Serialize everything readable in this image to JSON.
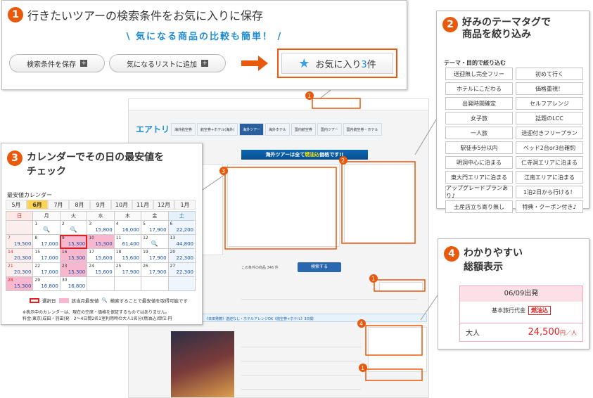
{
  "panel1": {
    "number": "1",
    "title": "行きたいツアーの検索条件をお気に入りに保存",
    "subtitle": "\\ 気になる商品の比較も簡単！ /",
    "save_label": "検索条件を保存",
    "add_label": "気になるリストに追加",
    "plus": "+",
    "fav_label": "お気に入り",
    "fav_count": "3",
    "fav_unit": "件",
    "icon": "star-icon"
  },
  "panel2": {
    "number": "2",
    "title_line1": "好みのテーマタグで",
    "title_line2": "商品を絞り込み",
    "section": "テーマ・目的で絞り込む",
    "tags": [
      "送迎無し完全フリー",
      "初めて行く",
      "ホテルにこだわる",
      "価格重視！",
      "出発時間確定",
      "セルフアレンジ",
      "女子旅",
      "話題のLCC",
      "一人旅",
      "送迎付きフリープラン",
      "駅徒歩5分以内",
      "ベッド2台or3台確約",
      "明洞中心に泊まる",
      "仁寺洞エリアに泊まる",
      "東大門エリアに泊まる",
      "江南エリアに泊まる",
      "アップグレードプランあり♪",
      "1泊2日から行ける！",
      "土産店立ち寄り無し",
      "特典・クーポン付き♪"
    ]
  },
  "panel3": {
    "number": "3",
    "title_line1": "カレンダーでその日の最安値を",
    "title_line2": "チェック",
    "calendar_label": "最安値カレンダー",
    "months": [
      "5月",
      "6月",
      "7月",
      "8月",
      "9月",
      "10月",
      "11月",
      "12月",
      "1月"
    ],
    "weekdays": [
      "日",
      "月",
      "火",
      "水",
      "木",
      "金",
      "土"
    ],
    "weeks": [
      [
        {
          "d": "",
          "p": ""
        },
        {
          "d": "1",
          "p": "",
          "mag": true
        },
        {
          "d": "2",
          "p": "",
          "mag": true
        },
        {
          "d": "3",
          "p": "15,800"
        },
        {
          "d": "4",
          "p": "16,000"
        },
        {
          "d": "5",
          "p": "17,900"
        },
        {
          "d": "6",
          "p": "22,200"
        }
      ],
      [
        {
          "d": "7",
          "p": "19,500"
        },
        {
          "d": "8",
          "p": "17,000"
        },
        {
          "d": "9",
          "p": "15,300",
          "sel": true,
          "cheap": true
        },
        {
          "d": "10",
          "p": "15,300",
          "cheap": true
        },
        {
          "d": "11",
          "p": "61,400"
        },
        {
          "d": "12",
          "p": "",
          "mag": true
        },
        {
          "d": "13",
          "p": "44,800"
        }
      ],
      [
        {
          "d": "14",
          "p": "20,300"
        },
        {
          "d": "15",
          "p": "17,000"
        },
        {
          "d": "16",
          "p": "15,300",
          "cheap": true
        },
        {
          "d": "17",
          "p": "15,600"
        },
        {
          "d": "18",
          "p": "15,600"
        },
        {
          "d": "19",
          "p": "17,900"
        },
        {
          "d": "20",
          "p": "22,300"
        }
      ],
      [
        {
          "d": "21",
          "p": "20,300"
        },
        {
          "d": "22",
          "p": "17,000"
        },
        {
          "d": "23",
          "p": "15,300",
          "cheap": true
        },
        {
          "d": "24",
          "p": "15,600"
        },
        {
          "d": "25",
          "p": "17,900"
        },
        {
          "d": "26",
          "p": "17,900"
        },
        {
          "d": "27",
          "p": "22,300"
        }
      ],
      [
        {
          "d": "28",
          "p": "15,300",
          "cheap": true
        },
        {
          "d": "29",
          "p": "16,800"
        },
        {
          "d": "30",
          "p": "16,800"
        },
        {
          "d": "",
          "p": ""
        },
        {
          "d": "",
          "p": ""
        },
        {
          "d": "",
          "p": ""
        },
        {
          "d": "",
          "p": ""
        }
      ]
    ],
    "legend_selected": "選択日",
    "legend_cheapest": "該当月最安値",
    "legend_search": "検索することで最安値を取得可能です",
    "note_line1": "※表示中のカレンダーは、現在の空席・価格を保証するものではありません。",
    "note_line2": "料金:東京(成田・羽田)発　2〜4日間2名1室利用時の大人1名分(燃油込)単位:円"
  },
  "panel4": {
    "number": "4",
    "title_line1": "わかりやすい",
    "title_line2": "総額表示",
    "date_label": "06/09出発",
    "base_label": "基本旅行代金",
    "fuel_label": "燃油込",
    "adult_label": "大人",
    "price": "24,500",
    "price_unit": "円／人"
  },
  "site": {
    "logo": "エアトリ",
    "band_pre": "海外ツアーは全て",
    "band_hi": "燃油込",
    "band_post": "価格です!!",
    "nav": [
      "海外航空券",
      "航空券+ホテル(海外)",
      "海外ツアー",
      "海外ホテル",
      "国内航空券",
      "国内ツアー",
      "国内航空券・ホテル",
      "新幹線・ホテル"
    ],
    "result_count": "この条件の商品 346 件",
    "search_btn": "検索する",
    "trip_title": "《日田発着》送迎なし・ホテルアレンジOK《航空券+ホテル》3日間",
    "city": "ソウル"
  }
}
